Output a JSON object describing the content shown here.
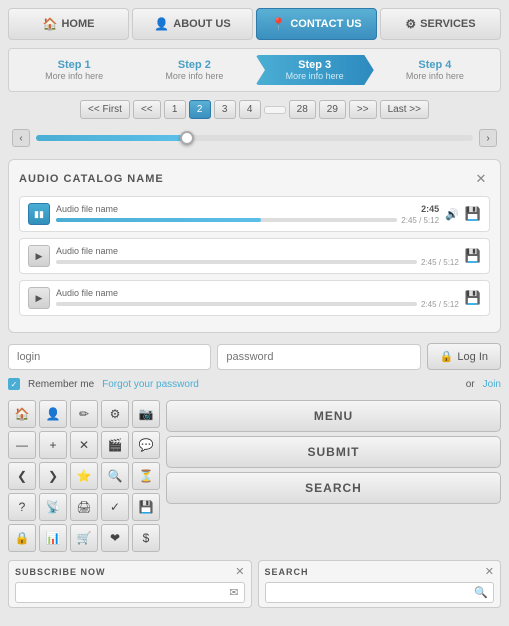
{
  "nav": {
    "items": [
      {
        "label": "HOME",
        "icon": "🏠",
        "active": false
      },
      {
        "label": "ABOUT US",
        "icon": "👤",
        "active": false
      },
      {
        "label": "CONTACT US",
        "icon": "📍",
        "active": true
      },
      {
        "label": "SERVICES",
        "icon": "⚙",
        "active": false
      }
    ]
  },
  "steps": [
    {
      "title": "Step 1",
      "sub": "More info here",
      "active": false
    },
    {
      "title": "Step 2",
      "sub": "More info here",
      "active": false
    },
    {
      "title": "Step 3",
      "sub": "More info here",
      "active": true
    },
    {
      "title": "Step 4",
      "sub": "More info here",
      "active": false
    }
  ],
  "pagination": {
    "first": "<< First",
    "prev_prev": "<<",
    "pages": [
      "1",
      "2",
      "3",
      "4",
      "...",
      "28",
      "29"
    ],
    "active_page": "2",
    "next_next": ">>",
    "last": "Last >>"
  },
  "audio": {
    "title": "AUDIO CATALOG NAME",
    "close": "✕",
    "tracks": [
      {
        "name": "Audio file name",
        "time": "2:45",
        "total": "2:45 / 5:12",
        "playing": true
      },
      {
        "name": "Audio file name",
        "time": "",
        "total": "2:45 / 5:12",
        "playing": false
      },
      {
        "name": "Audio file name",
        "time": "",
        "total": "2:45 / 5:12",
        "playing": false
      }
    ]
  },
  "login": {
    "login_placeholder": "login",
    "password_placeholder": "password",
    "login_btn": "Log In",
    "lock_icon": "🔒",
    "remember": "Remember me",
    "forgot": "Forgot your password",
    "or": "or",
    "join": "Join"
  },
  "icons": [
    "🏠",
    "👤",
    "✏",
    "⚙",
    "📷",
    "—",
    "+",
    "✕",
    "🎬",
    "💬",
    "❮",
    "❯",
    "⭐",
    "🔍",
    "⏳",
    "?",
    "📡",
    "🖨",
    "✓",
    "💾",
    "🔒",
    "📊",
    "🛒",
    "❤",
    "$"
  ],
  "buttons": {
    "menu": "MENU",
    "submit": "SUBMIT",
    "search": "SEARCH"
  },
  "subscribe": {
    "label": "SUBSCRIBE NOW",
    "close": "✕",
    "placeholder": "",
    "icon": "✉"
  },
  "search_box": {
    "label": "SEARCH",
    "close": "✕",
    "placeholder": "",
    "icon": "🔍"
  }
}
